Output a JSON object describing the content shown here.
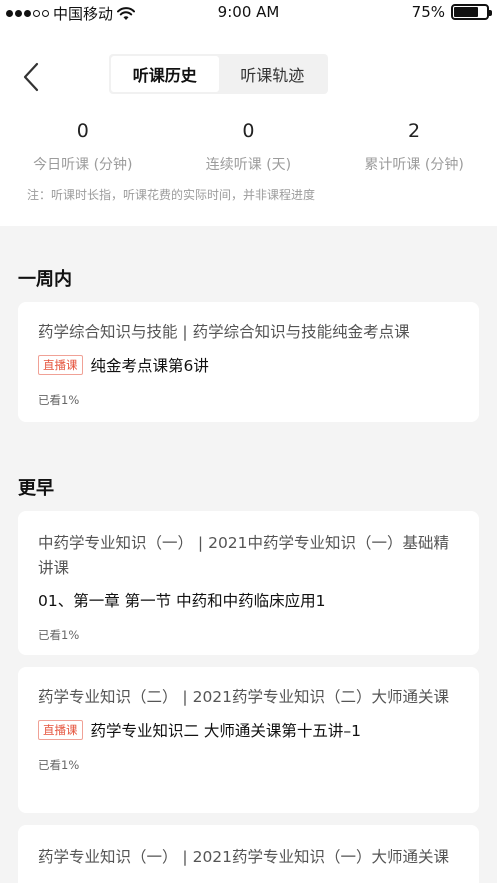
{
  "status_bar": {
    "carrier": "中国移动",
    "time": "9:00 AM",
    "battery_percent": "75%",
    "battery_level": 0.75,
    "signal_dots_filled": 3,
    "signal_dots_total": 5
  },
  "header": {
    "back_icon": "chevron-left-icon",
    "tabs": [
      {
        "label": "听课历史",
        "active": true
      },
      {
        "label": "听课轨迹",
        "active": false
      }
    ]
  },
  "stats": [
    {
      "value": "0",
      "label": "今日听课 (分钟)"
    },
    {
      "value": "0",
      "label": "连续听课 (天)"
    },
    {
      "value": "2",
      "label": "累计听课 (分钟)"
    }
  ],
  "note": "注：听课时长指，听课花费的实际时间，并非课程进度",
  "sections": [
    {
      "title": "一周内",
      "records": [
        {
          "course": "药学综合知识与技能 | 药学综合知识与技能纯金考点课",
          "badge": "直播课",
          "lesson": "纯金考点课第6讲",
          "progress": "已看1%"
        }
      ]
    },
    {
      "title": "更早",
      "records": [
        {
          "course": " 中药学专业知识（一） | 2021中药学专业知识（一）基础精讲课",
          "badge": "",
          "lesson": " 01、第一章 第一节 中药和中药临床应用1",
          "progress": "已看1%"
        },
        {
          "course": " 药学专业知识（二） | 2021药学专业知识（二）大师通关课",
          "badge": "直播课",
          "lesson": "药学专业知识二 大师通关课第十五讲–1",
          "progress": "已看1%"
        },
        {
          "course": " 药学专业知识（一） | 2021药学专业知识（一）大师通关课",
          "badge": "",
          "lesson": "",
          "progress": ""
        }
      ]
    }
  ],
  "colors": {
    "page_bg": "#f4f4f4",
    "card_bg": "#ffffff",
    "badge_red": "#e5533c",
    "muted_text": "#9c9c9c"
  }
}
